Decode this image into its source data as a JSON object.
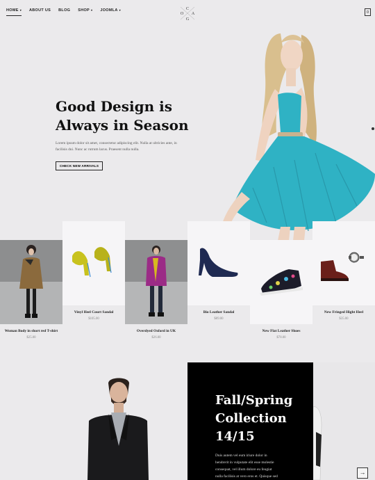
{
  "nav": {
    "home": "HOME",
    "about": "ABOUT US",
    "blog": "BLOG",
    "shop": "SHOP",
    "joomla": "JOOMLA"
  },
  "logo": {
    "letters": [
      "C",
      "O",
      "A",
      "G"
    ]
  },
  "cart": {
    "count": "0"
  },
  "hero": {
    "title_line1": "Good Design is",
    "title_line2": "Always in Season",
    "text": "Lorem ipsum dolor sit amet, consectetur adipiscing elit. Nulla at ultricies ante, in facilisis dui. Nunc ac rutrum lacus. Praesent nulla nulla.",
    "button": "CHECK NEW ARRIVALS"
  },
  "products": [
    {
      "name": "Woman Body in short red T-shirt",
      "price": "$25.00"
    },
    {
      "name": "Vinyl Heel Court Sandal",
      "price": "$105.00"
    },
    {
      "name": "Overdyed Oxford in UK",
      "price": "$26.00"
    },
    {
      "name": "Bio Leather Sandal",
      "price": "$89.00"
    },
    {
      "name": "New Flat Leather Shoes",
      "price": "$78.00"
    },
    {
      "name": "New Fringed Hight Heel",
      "price": "$35.00"
    }
  ],
  "collection": {
    "title_line1": "Fall/Spring",
    "title_line2": "Collection",
    "title_line3": "14/15",
    "body_line1": "Duis autem vel eum iriure dolor in",
    "body_line2": "hendrerit in vulputate elit esse molestie",
    "body_line3": "consequat, vel illum dolore eu feugiat",
    "body_line4": "nulla facilisis at vero eros et. Quisque sed"
  },
  "colors": {
    "accent_dress": "#2fb2c4",
    "background": "#ebeaec"
  }
}
